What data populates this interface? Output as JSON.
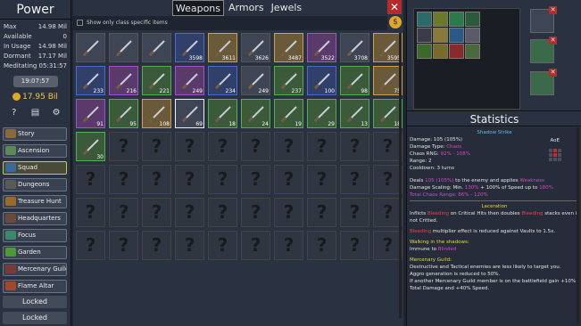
{
  "left": {
    "title": "Power",
    "stats": [
      {
        "label": "Max",
        "value": "14.98 Mil"
      },
      {
        "label": "Available",
        "value": "0"
      },
      {
        "label": "In Usage",
        "value": "14.98 Mil"
      },
      {
        "label": "Dormant",
        "value": "17.17 Mil"
      },
      {
        "label": "Meditating",
        "value": "05:31:57"
      }
    ],
    "timer": "19:07:57",
    "gold": "17.95 Bil",
    "nav": [
      "Story",
      "Ascension",
      "Squad",
      "Dungeons",
      "Treasure Hunt",
      "Headquarters",
      "Focus",
      "Garden",
      "Mercenary Guild",
      "Flame Altar"
    ],
    "locked": [
      "Locked",
      "Locked"
    ]
  },
  "tabs": [
    "Weapons",
    "Armors",
    "Jewels"
  ],
  "filter_label": "Show only class specific items",
  "grid": {
    "items": [
      {
        "c": ""
      },
      {
        "c": ""
      },
      {
        "c": ""
      },
      {
        "c": "3598"
      },
      {
        "c": "3611"
      },
      {
        "c": "3626"
      },
      {
        "c": "3487"
      },
      {
        "c": "3522"
      },
      {
        "c": "3708"
      },
      {
        "c": "3595"
      },
      {
        "c": "233"
      },
      {
        "c": "216"
      },
      {
        "c": "221"
      },
      {
        "c": "249"
      },
      {
        "c": "234"
      },
      {
        "c": "249"
      },
      {
        "c": "237"
      },
      {
        "c": "100"
      },
      {
        "c": "98"
      },
      {
        "c": "75"
      },
      {
        "c": "91"
      },
      {
        "c": "95"
      },
      {
        "c": "108"
      },
      {
        "c": "69"
      },
      {
        "c": "18"
      },
      {
        "c": "24"
      },
      {
        "c": "19"
      },
      {
        "c": "29"
      },
      {
        "c": "13"
      },
      {
        "c": "18"
      },
      {
        "c": "30"
      }
    ]
  },
  "stats": {
    "title": "Statistics",
    "skill": "Shadow Strike",
    "aoe": "AoE",
    "damage": "Damage: 105 (105%)",
    "damage_type_label": "Damage Type:",
    "damage_type": "Chaos",
    "chaos_rng_label": "Chaos RNG:",
    "chaos_rng": "92% - 108%",
    "range": "Range: 2",
    "cooldown": "Cooldown: 3 turns",
    "deals1": "Deals",
    "deals2": "105 (105%)",
    "deals3": "to the enemy and applies",
    "deals4": "Weakness",
    "scaling1": "Damage Scaling: Min.",
    "scaling2": "130%",
    "scaling3": "+ 100% of Speed up to",
    "scaling4": "180%",
    "chaos_range": "Total Chaos Range: 86% - 120%",
    "laceration": "Laceration",
    "lac1": "Inflicts",
    "lac2": "Bleeding",
    "lac3": "on Critical Hits then doubles",
    "lac4": "Bleeding",
    "lac5": "stacks even if not Critted.",
    "bleed1": "Bleeding",
    "bleed2": "multiplier effect is reduced against Vaults to 1.5x.",
    "shadows": "Walking in the shadows:",
    "immune1": "Immune to",
    "immune2": "Blinded",
    "merc": "Mercenary Guild:",
    "merc1": "Destructive and Tactical enemies are less likely to target you.",
    "merc2": "Aggro generation is reduced to 50%.",
    "merc3": "If another Mercenary Guild member is on the battlefield gain +10% Total Damage and +40% Speed."
  }
}
